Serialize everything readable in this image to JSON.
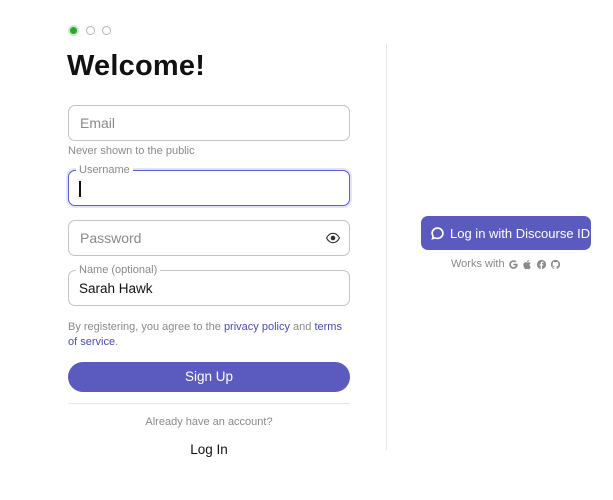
{
  "steps": {
    "total": 3,
    "active_index": 0,
    "active_color": "#2fa52f"
  },
  "title": "Welcome!",
  "form": {
    "email": {
      "placeholder": "Email",
      "value": ""
    },
    "email_hint": "Never shown to the public",
    "username": {
      "label": "Username",
      "value": ""
    },
    "password": {
      "placeholder": "Password",
      "value": "",
      "toggle_icon": "eye-icon"
    },
    "name": {
      "label": "Name (optional)",
      "value": "Sarah Hawk"
    }
  },
  "terms": {
    "prefix": "By registering, you agree to the ",
    "privacy_link": "privacy policy",
    "middle": " and ",
    "terms_link": "terms of service",
    "suffix": "."
  },
  "signup_button": "Sign Up",
  "already_text": "Already have an account?",
  "login_link": "Log In",
  "discourse_id": {
    "button_label": "Log in with Discourse ID",
    "icon": "chat-bubble-icon",
    "works_with": "Works with",
    "providers": [
      "google-icon",
      "apple-icon",
      "facebook-icon",
      "github-icon"
    ]
  },
  "colors": {
    "primary": "#5a5abf",
    "link": "#4a4bb5",
    "muted": "#8a8a8a",
    "focus_border": "#5c5dcc"
  }
}
